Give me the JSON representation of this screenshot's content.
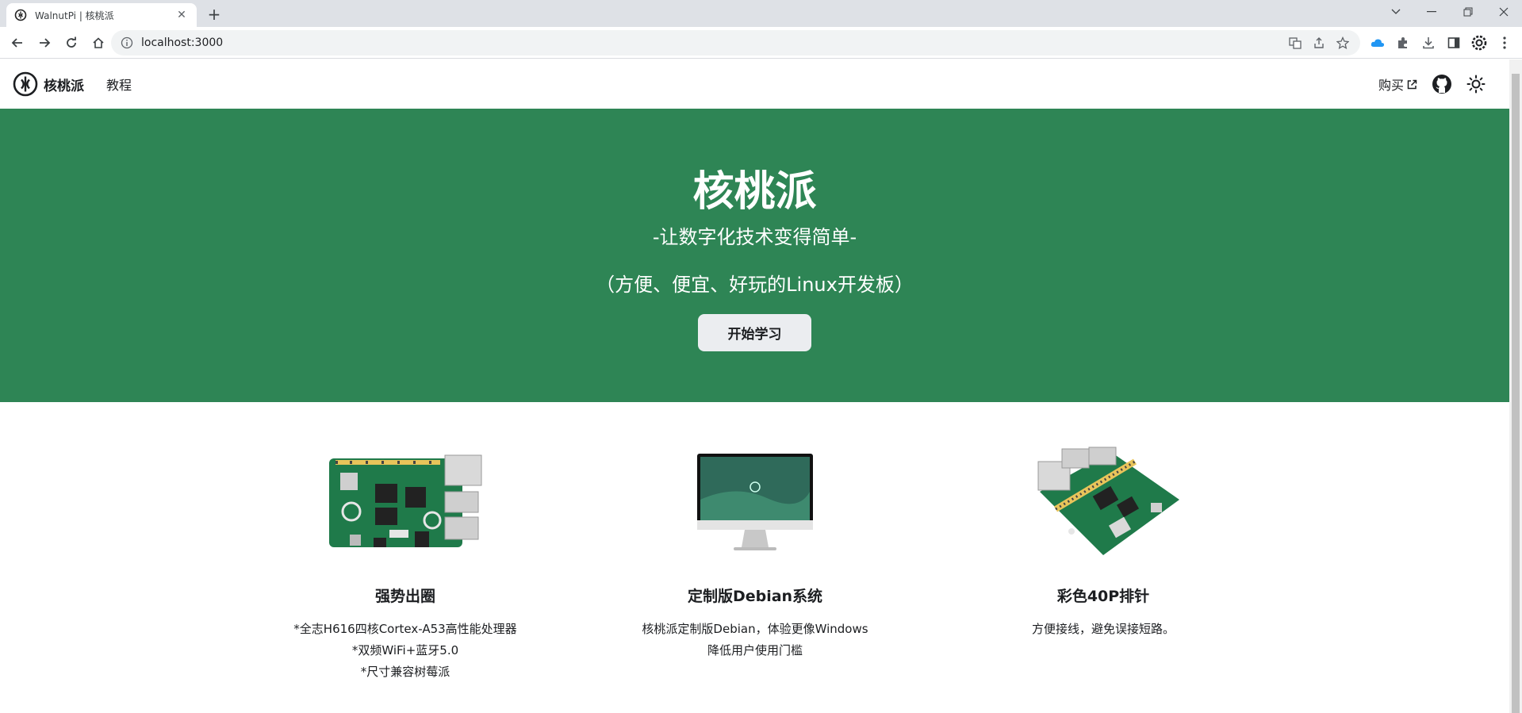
{
  "browser": {
    "tab_title": "WalnutPi | 核桃派",
    "new_tab": "+",
    "url": "localhost:3000"
  },
  "site": {
    "brand": "核桃派",
    "nav_tutorial": "教程",
    "nav_buy": "购买"
  },
  "hero": {
    "title": "核桃派",
    "tagline": "-让数字化技术变得简单-",
    "subtitle": "（方便、便宜、好玩的Linux开发板）",
    "button": "开始学习"
  },
  "features": [
    {
      "title": "强势出圈",
      "lines": [
        "*全志H616四核Cortex-A53高性能处理器",
        "*双频WiFi+蓝牙5.0",
        "*尺寸兼容树莓派"
      ]
    },
    {
      "title": "定制版Debian系统",
      "lines": [
        "核桃派定制版Debian，体验更像Windows",
        "降低用户使用门槛"
      ]
    },
    {
      "title": "彩色40P排针",
      "lines": [
        "方便接线，避免误接短路。"
      ]
    }
  ],
  "colors": {
    "hero_bg": "#2e8555",
    "button_bg": "#ebedf0",
    "pcb_green": "#1f7a4a"
  }
}
